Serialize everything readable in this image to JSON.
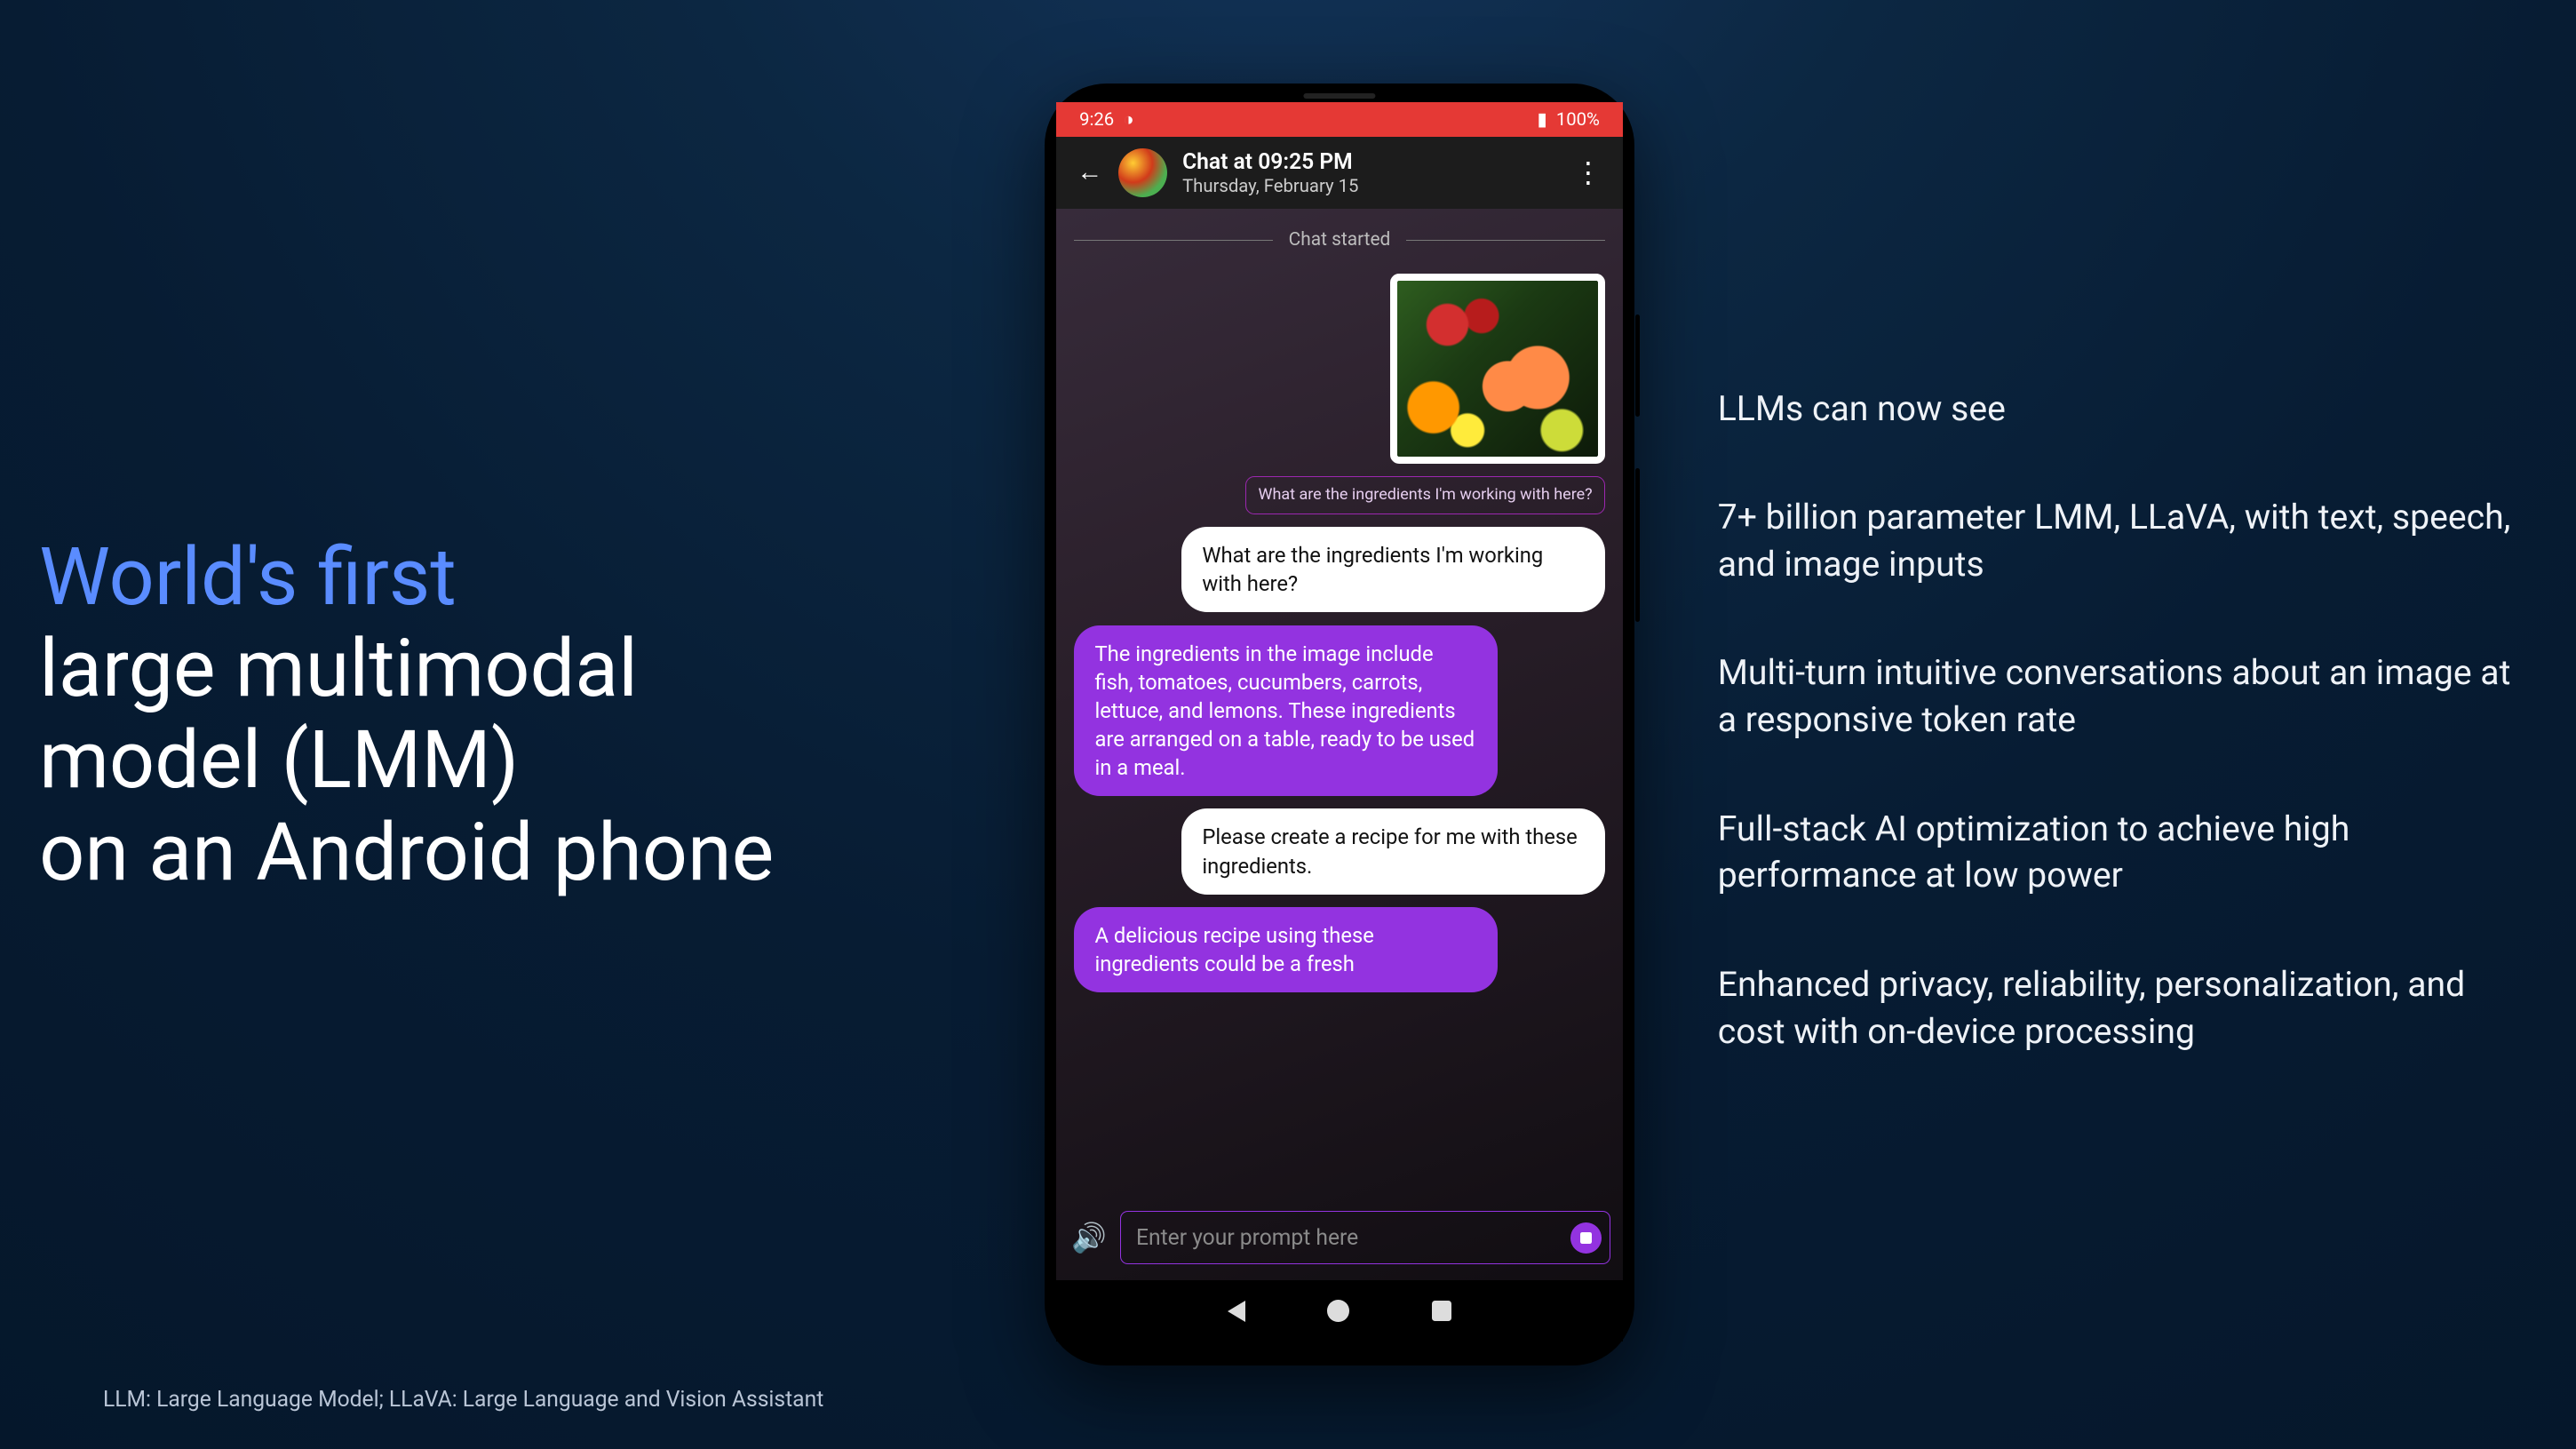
{
  "headline": {
    "accent": "World's first",
    "rest_line1": "large multimodal",
    "rest_line2": "model (LMM)",
    "rest_line3": "on an Android phone"
  },
  "bullets": [
    "LLMs can now see",
    "7+ billion parameter LMM, LLaVA, with text, speech, and image inputs",
    "Multi-turn intuitive conversations about an image at a responsive token rate",
    "Full-stack AI optimization to achieve high performance at low power",
    "Enhanced privacy, reliability, personalization, and cost with on-device processing"
  ],
  "footnote": "LLM: Large Language Model; LLaVA: Large Language and Vision Assistant",
  "phone": {
    "status": {
      "time": "9:26",
      "battery": "100%"
    },
    "appbar": {
      "title": "Chat at 09:25 PM",
      "subtitle": "Thursday, February 15"
    },
    "chat": {
      "started_label": "Chat started",
      "caption": "What are the ingredients I'm working with here?",
      "user_msg_1": "What are the ingredients I'm working with here?",
      "bot_msg_1": " The ingredients in the image include fish, tomatoes, cucumbers, carrots, lettuce, and lemons. These ingredients are arranged on a table, ready to be used in a meal.",
      "user_msg_2": "Please create a recipe for me with these ingredients.",
      "bot_msg_2": " A delicious recipe using these ingredients could be a fresh"
    },
    "input_placeholder": "Enter your prompt here"
  }
}
